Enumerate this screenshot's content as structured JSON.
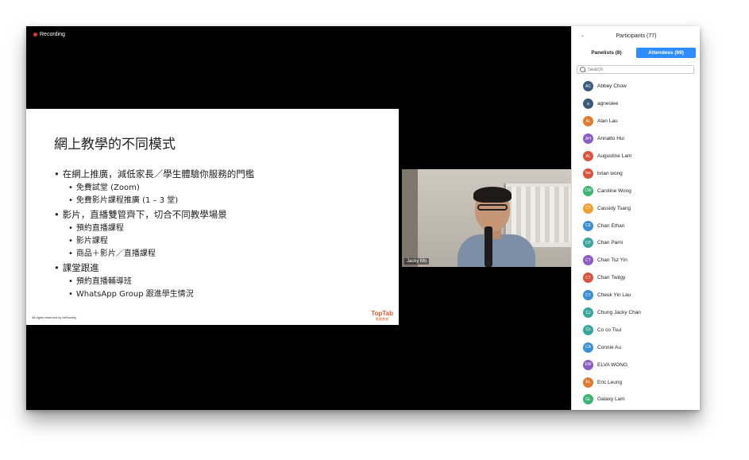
{
  "recording": {
    "label": "Recording",
    "color": "#e0352b"
  },
  "slide": {
    "title": "網上教學的不同模式",
    "bullets": [
      {
        "text": "在網上推廣，減低家長／學生體驗你服務的門檻",
        "sub": [
          "免費試堂 (Zoom)",
          "免費影片課程推廣 (1 – 3 堂)"
        ]
      },
      {
        "text": "影片，直播雙管齊下，切合不同教學場景",
        "sub": [
          "預約直播課程",
          "影片課程",
          "商品＋影片／直播課程"
        ]
      },
      {
        "text": "課堂跟進",
        "sub": [
          "預約直播輔導班",
          "WhatsApp Group 跟進學生情況"
        ]
      }
    ],
    "copyright": "All rights reserved by beNovelty",
    "logo_main": "TopTab",
    "logo_sub": "點點教育"
  },
  "video": {
    "name": "Jacky Mo"
  },
  "participants": {
    "title": "Participants (77)",
    "tabs": [
      {
        "label": "Panelists (8)",
        "active": false
      },
      {
        "label": "Attendees (69)",
        "active": true
      }
    ],
    "search_placeholder": "Search",
    "accent": "#2d8cff",
    "list": [
      {
        "initials": "AC",
        "name": "Abbey Chow",
        "color": "#3b5b7e"
      },
      {
        "initials": "a",
        "name": "agneslee",
        "color": "#3b5b7e"
      },
      {
        "initials": "AL",
        "name": "Alan Lau",
        "color": "#e07a2f"
      },
      {
        "initials": "AH",
        "name": "Annatto Hui",
        "color": "#8e5bc4"
      },
      {
        "initials": "AL",
        "name": "Augustine Lam",
        "color": "#d9533f"
      },
      {
        "initials": "bw",
        "name": "brian wong",
        "color": "#d9533f"
      },
      {
        "initials": "CW",
        "name": "Caroline Wong",
        "color": "#3cb371"
      },
      {
        "initials": "CT",
        "name": "Cassidy Tsang",
        "color": "#f0a030"
      },
      {
        "initials": "CE",
        "name": "Chan Ethan",
        "color": "#3a8fd6"
      },
      {
        "initials": "CP",
        "name": "Chan Pami",
        "color": "#3aa6a0"
      },
      {
        "initials": "CT",
        "name": "Chan Tsz Yin",
        "color": "#8e5bc4"
      },
      {
        "initials": "CT",
        "name": "Chan Twiigy",
        "color": "#d9533f"
      },
      {
        "initials": "CY",
        "name": "Cheuk Yin Lau",
        "color": "#3a8fd6"
      },
      {
        "initials": "CJ",
        "name": "Chung Jacky Chan",
        "color": "#3aa6a0"
      },
      {
        "initials": "Cc",
        "name": "Co co Tsui",
        "color": "#3aa6a0"
      },
      {
        "initials": "CA",
        "name": "Connie Au",
        "color": "#3a8fd6"
      },
      {
        "initials": "EW",
        "name": "ELVA WONG",
        "color": "#8e5bc4"
      },
      {
        "initials": "EL",
        "name": "Eric Leung",
        "color": "#e07a2f"
      },
      {
        "initials": "GL",
        "name": "Galaxy Lam",
        "color": "#3cb371"
      }
    ]
  }
}
